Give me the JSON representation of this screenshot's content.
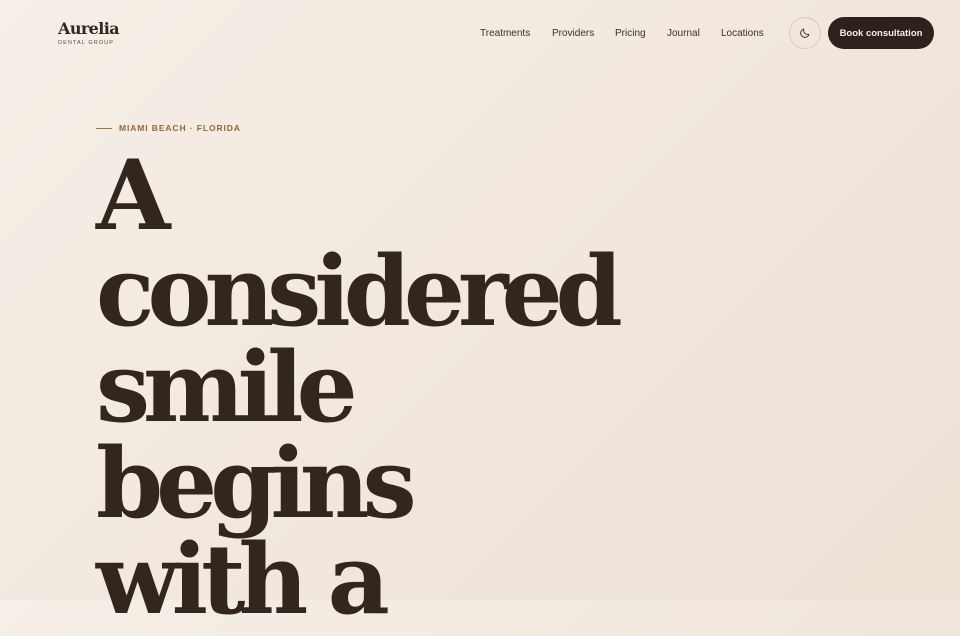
{
  "brand": {
    "name": "Aurelia",
    "subtitle": "DENTAL GROUP"
  },
  "nav": {
    "items": [
      {
        "label": "Treatments"
      },
      {
        "label": "Providers"
      },
      {
        "label": "Pricing"
      },
      {
        "label": "Journal"
      },
      {
        "label": "Locations"
      }
    ]
  },
  "header": {
    "theme_toggle_icon": "moon-icon",
    "cta_label": "Book consultation"
  },
  "hero": {
    "eyebrow": "MIAMI BEACH · FLORIDA",
    "headline_lines": [
      "A",
      "considered",
      "smile",
      "begins",
      "with a"
    ]
  },
  "colors": {
    "background": "#f4ece3",
    "text": "#33261e",
    "accent": "#8f6a3f",
    "button": "#2e211b"
  }
}
